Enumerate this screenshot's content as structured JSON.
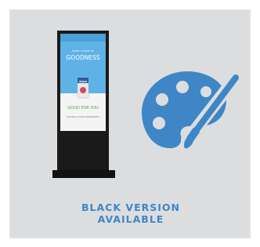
{
  "card": {
    "caption_line1": "BLACK VERSION",
    "caption_line2": "AVAILABLE",
    "accent_color": "#3e86c6"
  },
  "kiosk": {
    "screen_headline": "GOODNESS",
    "screen_kicker": "EVERY FLAVOR OF",
    "product_brand": "alpro",
    "screen_tagline": "GOOD FOR YOU",
    "screen_footer": "NATURALLY GOOD INGREDIENTS"
  },
  "icons": {
    "palette": "palette-icon"
  }
}
